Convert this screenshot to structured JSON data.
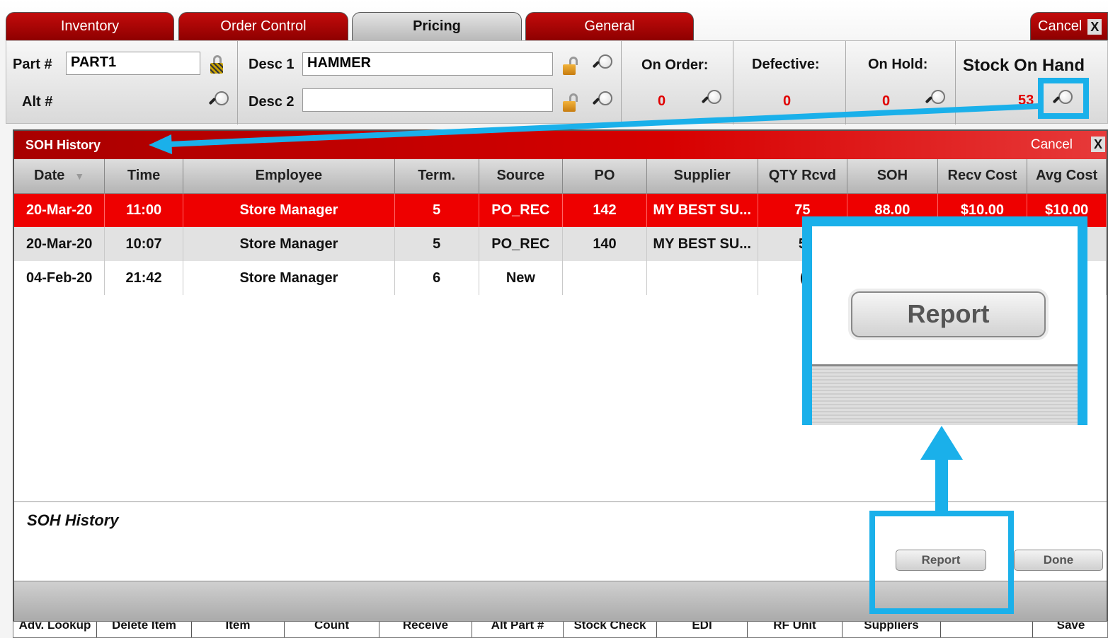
{
  "tabs": [
    {
      "label": "Inventory",
      "active": false
    },
    {
      "label": "Order Control",
      "active": false
    },
    {
      "label": "Pricing",
      "active": true
    },
    {
      "label": "General",
      "active": false
    }
  ],
  "top_cancel": {
    "label": "Cancel",
    "close": "X"
  },
  "header": {
    "part_label": "Part #",
    "part_value": "PART1",
    "alt_label": "Alt #",
    "alt_value": "",
    "desc1_label": "Desc 1",
    "desc1_value": "HAMMER",
    "desc2_label": "Desc 2",
    "desc2_value": "",
    "on_order_label": "On Order:",
    "on_order_value": "0",
    "defective_label": "Defective:",
    "defective_value": "0",
    "on_hold_label": "On Hold:",
    "on_hold_value": "0",
    "soh_label": "Stock On Hand",
    "soh_value": "53"
  },
  "dialog": {
    "title": "SOH History",
    "cancel": "Cancel",
    "close": "X",
    "columns": [
      "Date",
      "Time",
      "Employee",
      "Term.",
      "Source",
      "PO",
      "Supplier",
      "QTY Rcvd",
      "SOH",
      "Recv Cost",
      "Avg Cost"
    ],
    "rows": [
      {
        "date": "20-Mar-20",
        "time": "11:00",
        "employee": "Store Manager",
        "term": "5",
        "source": "PO_REC",
        "po": "142",
        "supplier": "MY BEST SU...",
        "qty": "75",
        "soh": "88.00",
        "recv_cost": "$10.00",
        "avg_cost": "$10.00"
      },
      {
        "date": "20-Mar-20",
        "time": "10:07",
        "employee": "Store Manager",
        "term": "5",
        "source": "PO_REC",
        "po": "140",
        "supplier": "MY BEST SU...",
        "qty": "5",
        "soh": "",
        "recv_cost": "",
        "avg_cost": ")"
      },
      {
        "date": "04-Feb-20",
        "time": "21:42",
        "employee": "Store Manager",
        "term": "6",
        "source": "New",
        "po": "",
        "supplier": "",
        "qty": "(",
        "soh": "",
        "recv_cost": "",
        "avg_cost": ")"
      }
    ],
    "footer_title": "SOH History",
    "report_button": "Report",
    "done_button": "Done"
  },
  "bottom_toolbar": [
    "Adv. Lookup",
    "Delete Item",
    "Item",
    "Count",
    "Receive",
    "Alt Part #",
    "Stock Check",
    "EDI",
    "RF Unit",
    "Suppliers",
    "",
    "Save"
  ],
  "callout": {
    "report_button": "Report"
  },
  "colors": {
    "brand_red": "#c30b0b",
    "selected_row": "#ee0000",
    "highlight": "#1ab0ea",
    "value_red": "#e00000"
  }
}
